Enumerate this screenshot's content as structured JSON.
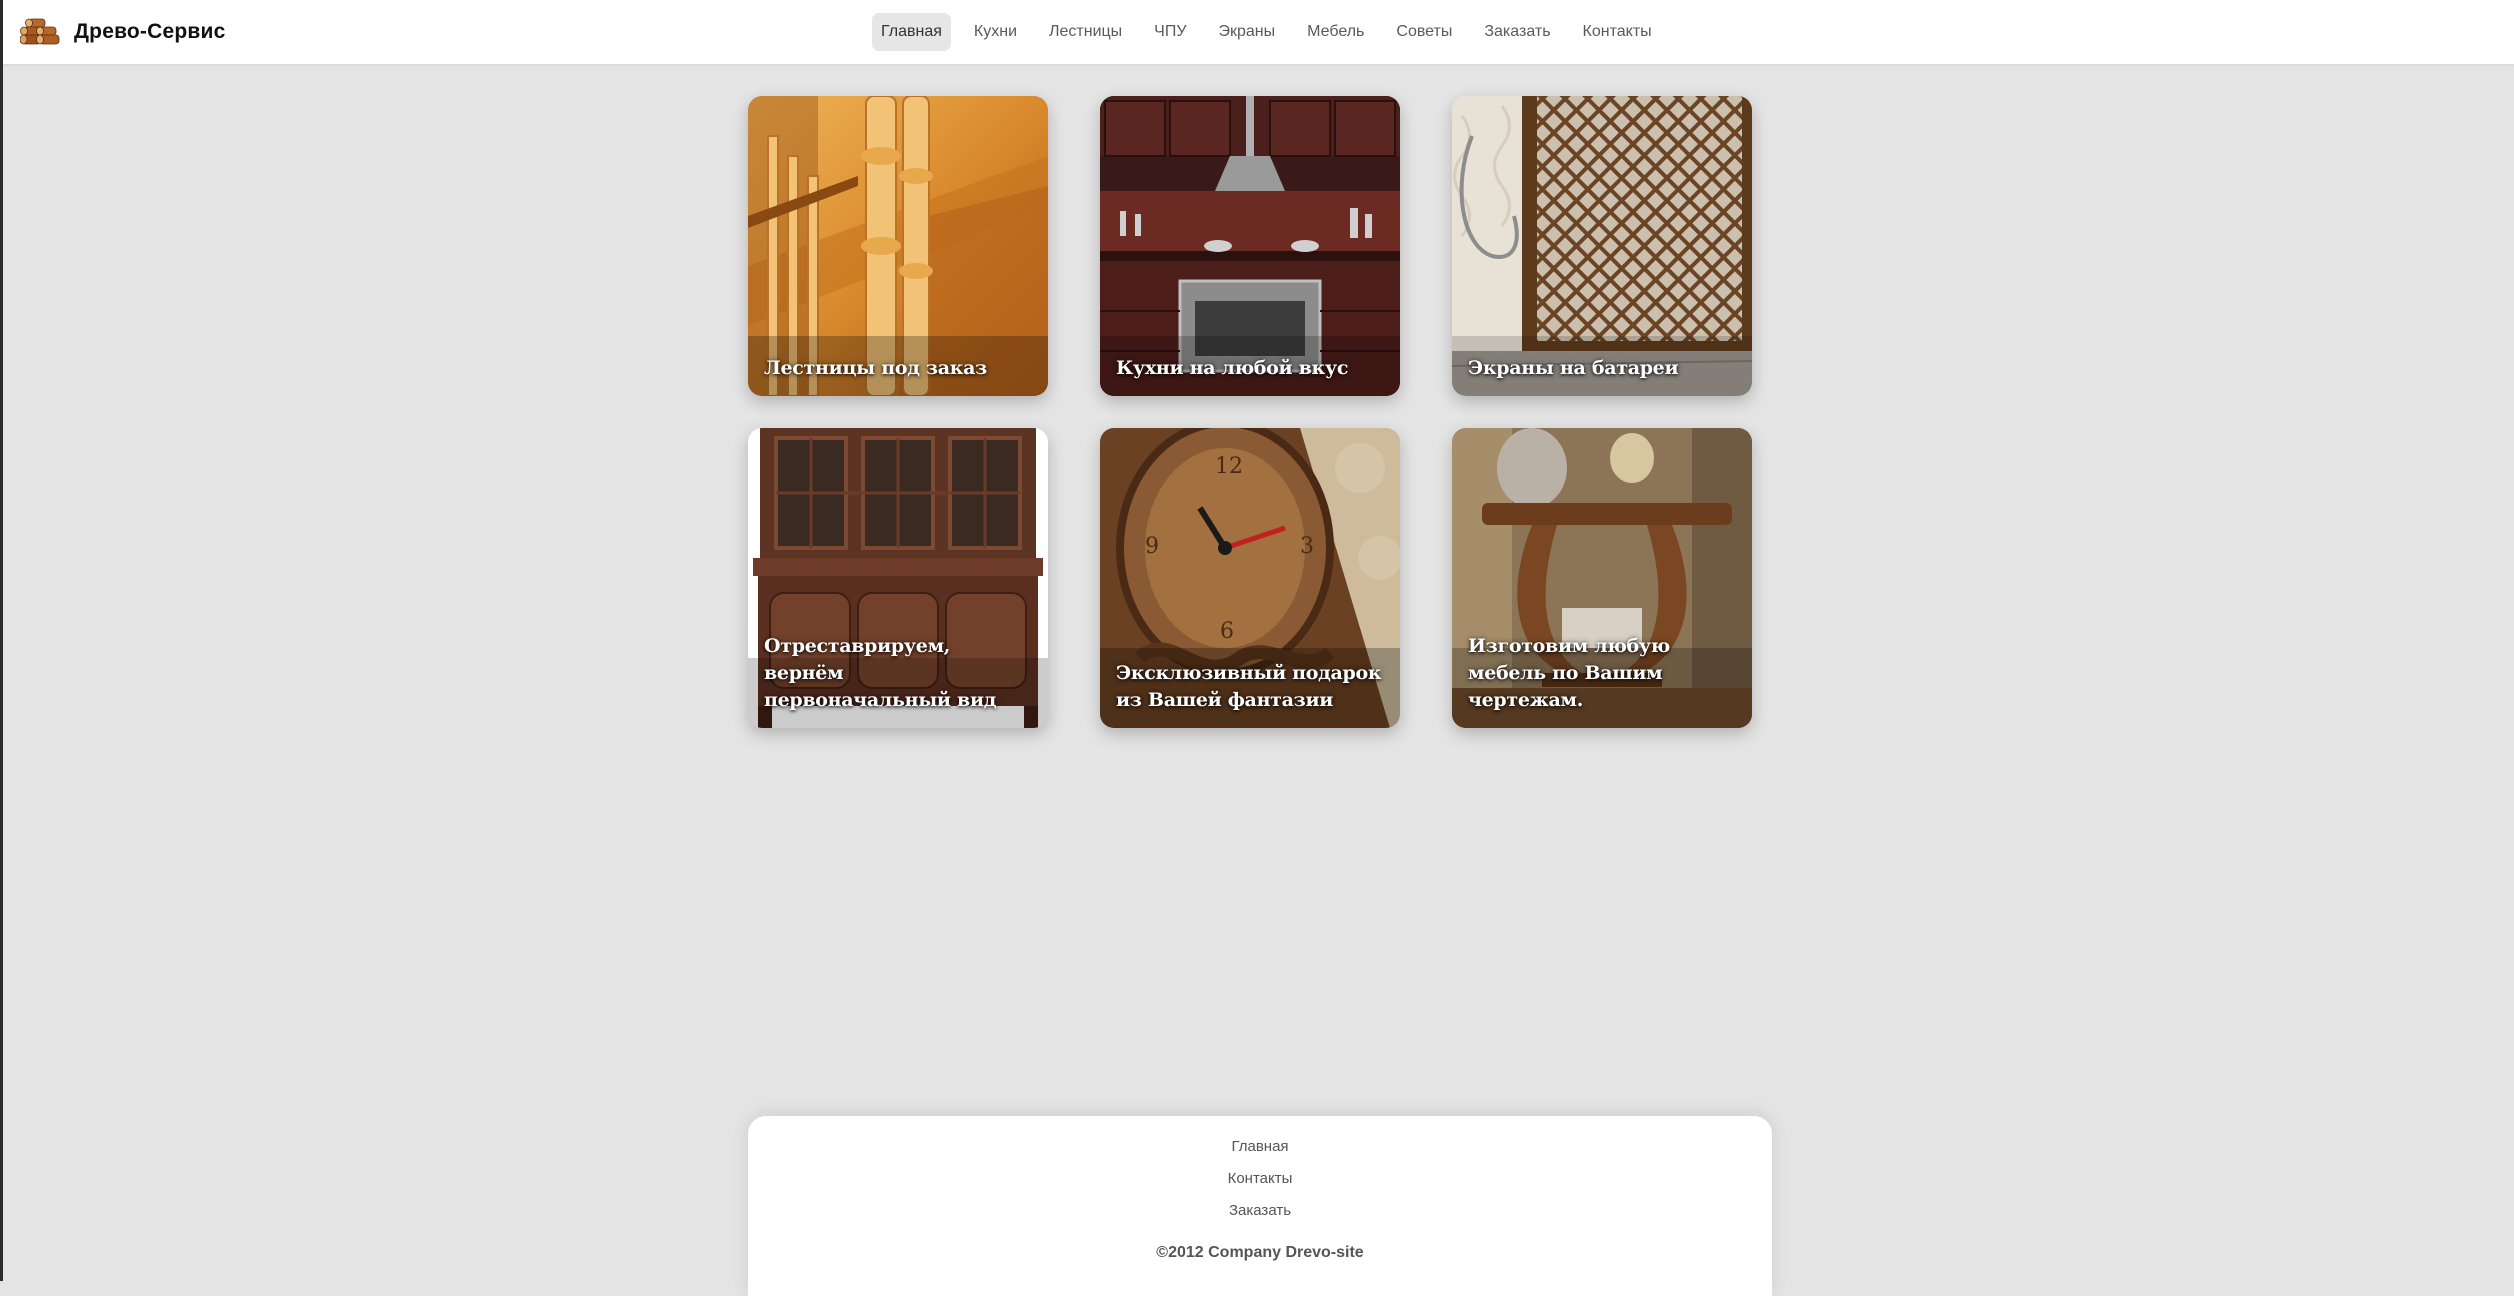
{
  "brand": {
    "name": "Древо-Сервис",
    "logo_icon": "stacked-logs-icon"
  },
  "nav": {
    "items": [
      {
        "label": "Главная",
        "active": true
      },
      {
        "label": "Кухни",
        "active": false
      },
      {
        "label": "Лестницы",
        "active": false
      },
      {
        "label": "ЧПУ",
        "active": false
      },
      {
        "label": "Экраны",
        "active": false
      },
      {
        "label": "Мебель",
        "active": false
      },
      {
        "label": "Советы",
        "active": false
      },
      {
        "label": "Заказать",
        "active": false
      },
      {
        "label": "Контакты",
        "active": false
      }
    ]
  },
  "cards": [
    {
      "caption": "Лестницы под заказ",
      "image": "wooden-staircase-photo"
    },
    {
      "caption": "Кухни на любой вкус",
      "image": "kitchen-photo"
    },
    {
      "caption": "Экраны на батареи",
      "image": "radiator-screen-photo"
    },
    {
      "caption": "Отреставрируем, вернём первоначальный вид",
      "image": "antique-cabinet-photo"
    },
    {
      "caption": "Эксклюзивный подарок из Вашей фантазии",
      "image": "carved-clock-photo"
    },
    {
      "caption": "Изготовим любую мебель по Вашим чертежам.",
      "image": "custom-table-photo"
    }
  ],
  "footer": {
    "links": [
      "Главная",
      "Контакты",
      "Заказать"
    ],
    "copyright": "©2012 Company Drevo-site"
  },
  "colors": {
    "page_background": "#e4e4e4",
    "nav_active_background": "#e6e6e6",
    "surface": "#ffffff"
  }
}
